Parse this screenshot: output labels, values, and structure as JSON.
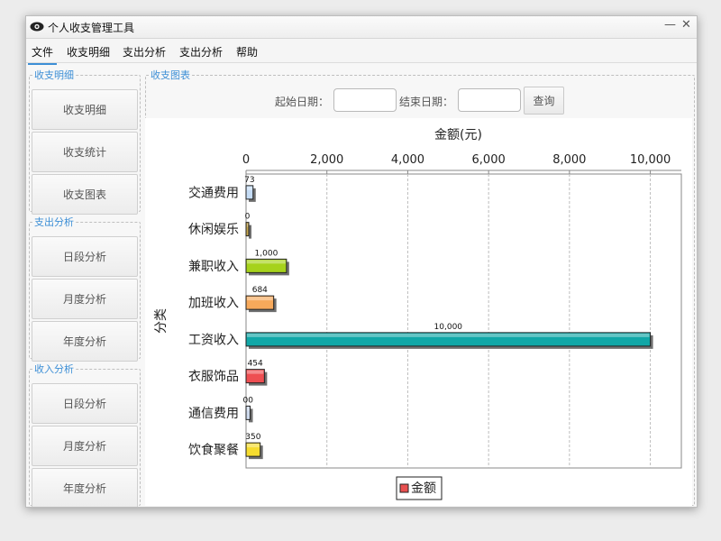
{
  "window": {
    "title": "个人收支管理工具"
  },
  "menu": [
    "文件",
    "收支明细",
    "支出分析",
    "支出分析",
    "帮助"
  ],
  "groups": {
    "detail": {
      "title": "收支明细",
      "buttons": [
        "收支明细",
        "收支统计",
        "收支图表"
      ]
    },
    "expense": {
      "title": "支出分析",
      "buttons": [
        "日段分析",
        "月度分析",
        "年度分析"
      ]
    },
    "income": {
      "title": "收入分析",
      "buttons": [
        "日段分析",
        "月度分析",
        "年度分析"
      ]
    }
  },
  "chart_panel": {
    "title": "收支图表",
    "start_label": "起始日期：",
    "end_label": "结束日期：",
    "start_value": "",
    "end_value": "",
    "query_label": "查询"
  },
  "chart_data": {
    "type": "bar",
    "orientation": "horizontal",
    "xlabel": "金额(元)",
    "ylabel": "分类",
    "xlim": [
      0,
      10500
    ],
    "ticks": [
      0,
      2000,
      4000,
      6000,
      8000,
      10000
    ],
    "tick_labels": [
      "0",
      "2,000",
      "4,000",
      "6,000",
      "8,000",
      "10,000"
    ],
    "grid": true,
    "categories": [
      "交通费用",
      "休闲娱乐",
      "兼职收入",
      "加班收入",
      "工资收入",
      "衣服饰品",
      "通信费用",
      "饮食聚餐"
    ],
    "values": [
      173,
      20,
      1000,
      684,
      10000,
      454,
      100,
      350
    ],
    "value_labels": [
      "73",
      "0",
      "1,000",
      "684",
      "10,000",
      "454",
      "00",
      "350"
    ],
    "bar_colors": [
      "#c5dcf5",
      "#c8a84e",
      "#a6d21b",
      "#f7a95b",
      "#11a7a7",
      "#ee4f52",
      "#cdd9ec",
      "#f6dc2f"
    ],
    "legend": {
      "label": "金额",
      "position": "bottom",
      "color": "#e85050"
    }
  }
}
